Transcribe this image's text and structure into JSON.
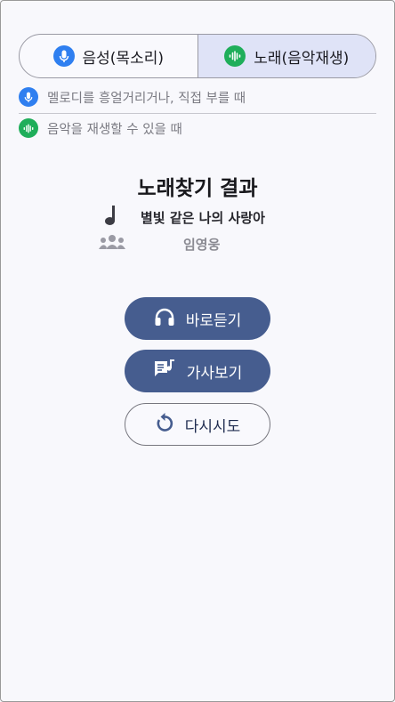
{
  "mode_tabs": [
    {
      "label": "음성(목소리)",
      "icon": "mic-icon",
      "color": "#2f7ff0",
      "active": false
    },
    {
      "label": "노래(음악재생)",
      "icon": "sound-wave-icon",
      "color": "#1fae5a",
      "active": true
    }
  ],
  "hints": [
    {
      "text": "멜로디를 흥얼거리거나, 직접 부를 때",
      "icon": "mic-icon"
    },
    {
      "text": "음악을 재생할 수 있을 때",
      "icon": "sound-wave-icon"
    }
  ],
  "result": {
    "title": "노래찾기 결과",
    "song": "별빛 같은 나의 사랑아",
    "artist": "임영웅"
  },
  "actions": {
    "listen": "바로듣기",
    "lyrics": "가사보기",
    "retry": "다시시도"
  },
  "colors": {
    "accent": "#465d8f",
    "active_tab_bg": "#dfe3f7",
    "mic_blue": "#2f7ff0",
    "wave_green": "#1fae5a"
  }
}
